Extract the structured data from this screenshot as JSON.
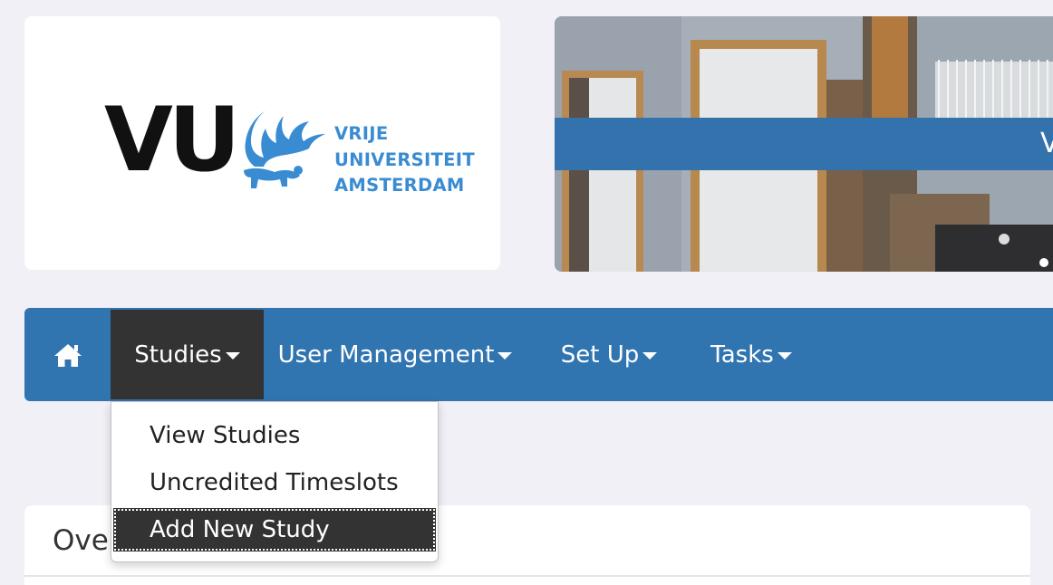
{
  "logo": {
    "mark": "VU",
    "name_lines": [
      "VRIJE",
      "UNIVERSITEIT",
      "AMSTERDAM"
    ],
    "brand_color": "#3a8cd2"
  },
  "banner": {
    "partial_text": "V",
    "strip_color": "#3372ad"
  },
  "navbar": {
    "color": "#3175b0",
    "home_icon": "home-icon",
    "items": [
      {
        "label": "Studies",
        "active": true
      },
      {
        "label": "User Management",
        "active": false
      },
      {
        "label": "Set Up",
        "active": false
      },
      {
        "label": "Tasks",
        "active": false
      }
    ]
  },
  "dropdown": {
    "items": [
      {
        "label": "View Studies",
        "highlighted": false
      },
      {
        "label": "Uncredited Timeslots",
        "highlighted": false
      },
      {
        "label": "Add New Study",
        "highlighted": true
      }
    ]
  },
  "panel": {
    "title": "Overview"
  }
}
